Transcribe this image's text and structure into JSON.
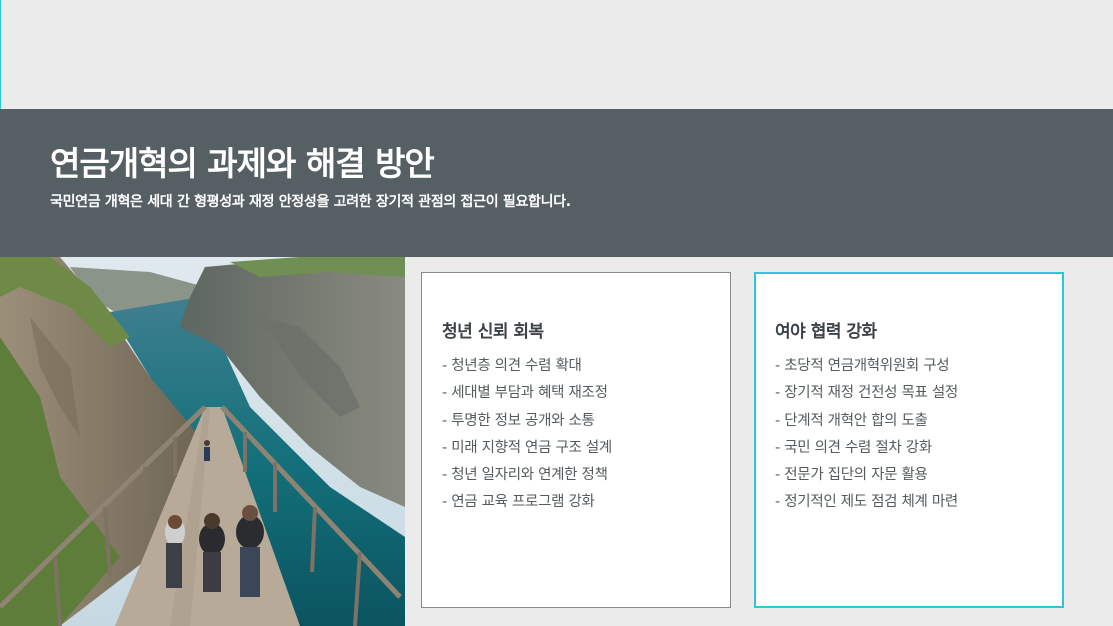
{
  "header": {
    "title": "연금개혁의 과제와 해결 방안",
    "subtitle": "국민연금 개혁은 세대 간 형평성과 재정 안정성을 고려한 장기적 관점의 접근이 필요합니다."
  },
  "photo": {
    "icon": "coastal-cliff-walkway-photo"
  },
  "cards": [
    {
      "title": "청년 신뢰 회복",
      "items": [
        "- 청년층 의견 수렴 확대",
        "- 세대별 부담과 혜택 재조정",
        "- 투명한 정보 공개와 소통",
        "- 미래 지향적 연금 구조 설계",
        "- 청년 일자리와 연계한 정책",
        "- 연금 교육 프로그램 강화"
      ]
    },
    {
      "title": "여야 협력 강화",
      "items": [
        "- 초당적 연금개혁위원회 구성",
        "- 장기적 재정 건전성 목표 설정",
        "- 단계적 개혁안 합의 도출",
        "- 국민 의견 수렴 절차 강화",
        "- 전문가 집단의 자문 활용",
        "- 정기적인 제도 점검 체계 마련"
      ]
    }
  ],
  "colors": {
    "banner": "#566064",
    "accent": "#2ec7d8",
    "background": "#ebebeb"
  }
}
